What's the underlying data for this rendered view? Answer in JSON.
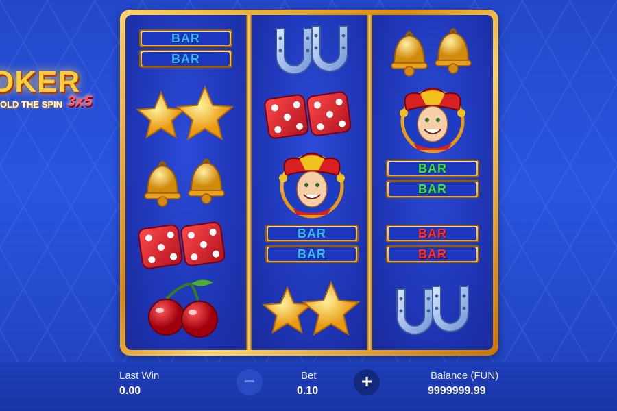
{
  "logo": {
    "word": "OKER",
    "subtitle": "OLD THE SPIN",
    "variant": "3x5"
  },
  "reels": [
    [
      "bar-double-blue",
      "star-double",
      "bell-double",
      "dice-double",
      "cherry-double"
    ],
    [
      "horseshoe-double",
      "dice-double",
      "joker",
      "bar-double-blue",
      "star-double"
    ],
    [
      "bell-double",
      "joker",
      "bar-double-green",
      "bar-double-red",
      "horseshoe-double"
    ]
  ],
  "bar_label": "BAR",
  "footer": {
    "last_win_label": "Last Win",
    "last_win_value": "0.00",
    "bet_label": "Bet",
    "bet_value": "0.10",
    "balance_label": "Balance (FUN)",
    "balance_value": "9999999.99",
    "minus_symbol": "−",
    "plus_symbol": "+"
  },
  "colors": {
    "frame_gold": "#e8a21b",
    "reel_blue": "#1d33b0",
    "bar_blue": "#36b8ff",
    "bar_green": "#3ee04a",
    "bar_red": "#ff3030"
  }
}
